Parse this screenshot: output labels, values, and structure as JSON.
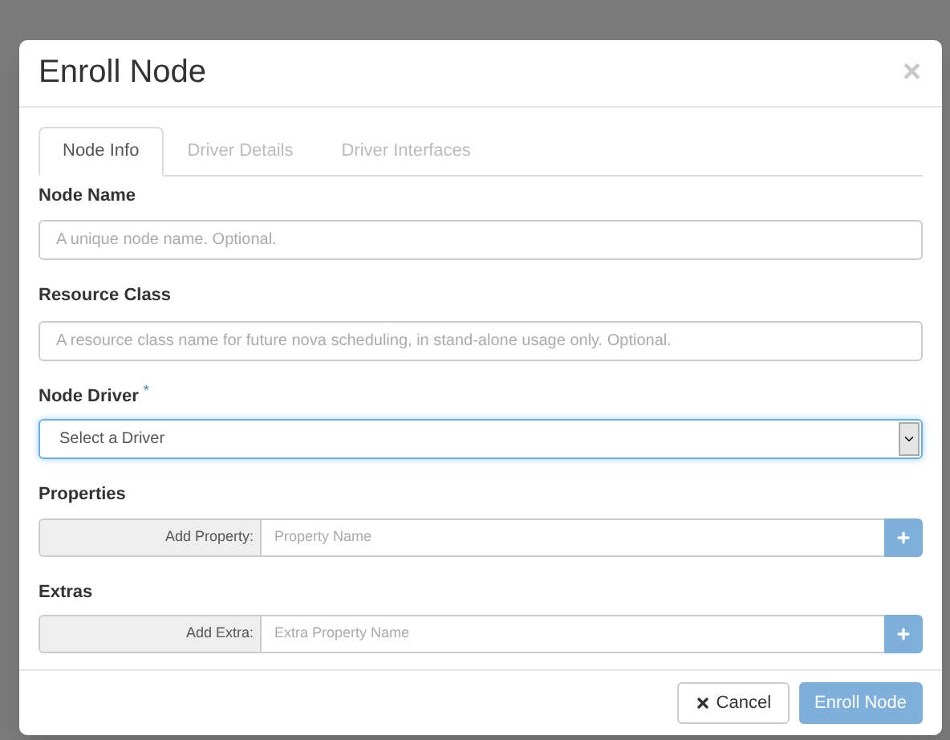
{
  "dialog": {
    "title": "Enroll Node",
    "close": "×"
  },
  "tabs": [
    {
      "label": "Node Info",
      "selected": true,
      "disabled": false
    },
    {
      "label": "Driver Details",
      "selected": false,
      "disabled": true
    },
    {
      "label": "Driver Interfaces",
      "selected": false,
      "disabled": true
    }
  ],
  "fields": [
    {
      "kind": "text",
      "label": "Node Name",
      "placeholder": "A unique node name. Optional."
    },
    {
      "kind": "text",
      "label": "Resource Class",
      "placeholder": "A resource class name for future nova scheduling, in stand-alone usage only. Optional."
    },
    {
      "kind": "select",
      "label": "Node Driver",
      "required_mark": "*",
      "value": "Select a Driver"
    },
    {
      "kind": "adder",
      "label": "Properties",
      "addon": "Add Property:",
      "placeholder": "Property Name",
      "add_disabled": true
    },
    {
      "kind": "adder",
      "label": "Extras",
      "addon": "Add Extra:",
      "placeholder": "Extra Property Name",
      "add_disabled": true
    }
  ],
  "footer": {
    "cancel": "Cancel",
    "submit": "Enroll Node",
    "submit_disabled": true
  }
}
